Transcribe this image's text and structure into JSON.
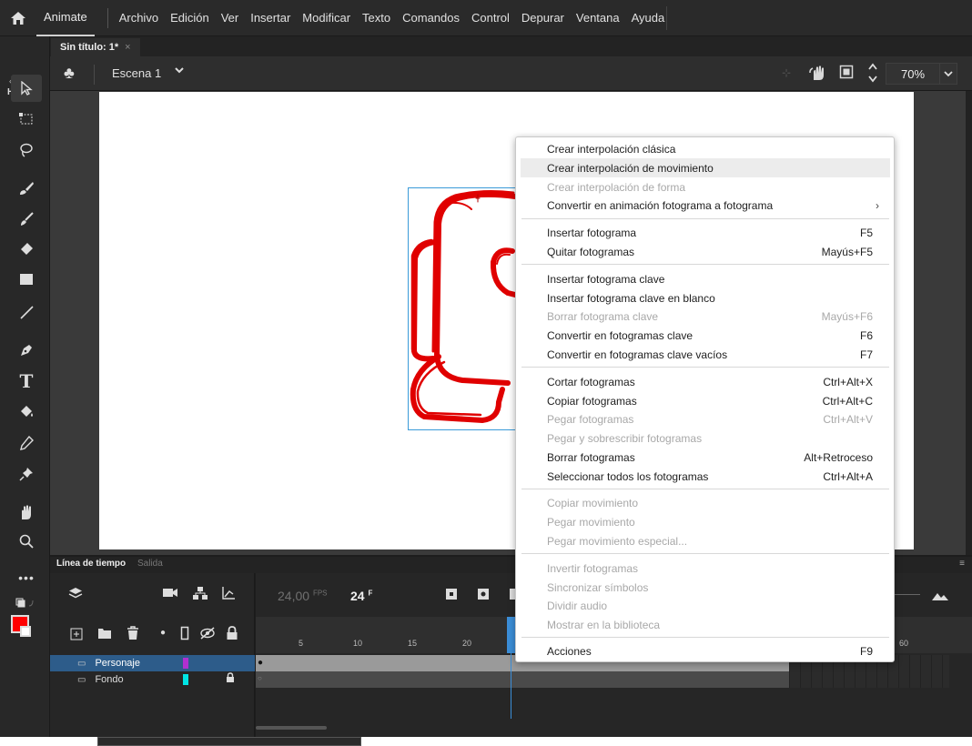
{
  "app": {
    "name": "Animate",
    "menus": [
      "Archivo",
      "Edición",
      "Ver",
      "Insertar",
      "Modificar",
      "Texto",
      "Comandos",
      "Control",
      "Depurar",
      "Ventana",
      "Ayuda"
    ]
  },
  "document": {
    "tab_title": "Sin título: 1*",
    "close": "×"
  },
  "toolbar_header": "H",
  "scene": {
    "name": "Escena 1",
    "zoom": "70%"
  },
  "timeline": {
    "tab_active": "Línea de tiempo",
    "tab_inactive": "Salida",
    "fps": "24,00",
    "fps_unit": "FPS",
    "frame": "24",
    "frame_unit": "F",
    "ruler_labels": [
      "5",
      "10",
      "15",
      "20",
      "60"
    ],
    "layers": [
      {
        "name": "Personaje",
        "color": "#b030d0",
        "selected": true
      },
      {
        "name": "Fondo",
        "color": "#00e5e5",
        "selected": false,
        "locked": true
      }
    ]
  },
  "colors": {
    "stroke": "#ff0000",
    "highlight": "#2d5c8a",
    "drawing": "#e00000"
  },
  "context_menu": {
    "items": [
      {
        "label": "Crear interpolación clásica",
        "shortcut": "",
        "disabled": false
      },
      {
        "label": "Crear interpolación de movimiento",
        "shortcut": "",
        "disabled": false,
        "hover": true
      },
      {
        "label": "Crear interpolación de forma",
        "shortcut": "",
        "disabled": true
      },
      {
        "label": "Convertir en animación fotograma a fotograma",
        "shortcut": "",
        "disabled": false,
        "submenu": true
      },
      {
        "label": "Insertar fotograma",
        "shortcut": "F5",
        "disabled": false
      },
      {
        "label": "Quitar fotogramas",
        "shortcut": "Mayús+F5",
        "disabled": false
      },
      {
        "label": "Insertar fotograma clave",
        "shortcut": "",
        "disabled": false
      },
      {
        "label": "Insertar fotograma clave en blanco",
        "shortcut": "",
        "disabled": false
      },
      {
        "label": "Borrar fotograma clave",
        "shortcut": "Mayús+F6",
        "disabled": true
      },
      {
        "label": "Convertir en fotogramas clave",
        "shortcut": "F6",
        "disabled": false
      },
      {
        "label": "Convertir en fotogramas clave vacíos",
        "shortcut": "F7",
        "disabled": false
      },
      {
        "label": "Cortar fotogramas",
        "shortcut": "Ctrl+Alt+X",
        "disabled": false
      },
      {
        "label": "Copiar fotogramas",
        "shortcut": "Ctrl+Alt+C",
        "disabled": false
      },
      {
        "label": "Pegar fotogramas",
        "shortcut": "Ctrl+Alt+V",
        "disabled": true
      },
      {
        "label": "Pegar y sobrescribir fotogramas",
        "shortcut": "",
        "disabled": true
      },
      {
        "label": "Borrar fotogramas",
        "shortcut": "Alt+Retroceso",
        "disabled": false
      },
      {
        "label": "Seleccionar todos los fotogramas",
        "shortcut": "Ctrl+Alt+A",
        "disabled": false
      },
      {
        "label": "Copiar movimiento",
        "shortcut": "",
        "disabled": true
      },
      {
        "label": "Pegar movimiento",
        "shortcut": "",
        "disabled": true
      },
      {
        "label": "Pegar movimiento especial...",
        "shortcut": "",
        "disabled": true
      },
      {
        "label": "Invertir fotogramas",
        "shortcut": "",
        "disabled": true
      },
      {
        "label": "Sincronizar símbolos",
        "shortcut": "",
        "disabled": true
      },
      {
        "label": "Dividir audio",
        "shortcut": "",
        "disabled": true
      },
      {
        "label": "Mostrar en la biblioteca",
        "shortcut": "",
        "disabled": true
      },
      {
        "label": "Acciones",
        "shortcut": "F9",
        "disabled": false
      }
    ]
  }
}
